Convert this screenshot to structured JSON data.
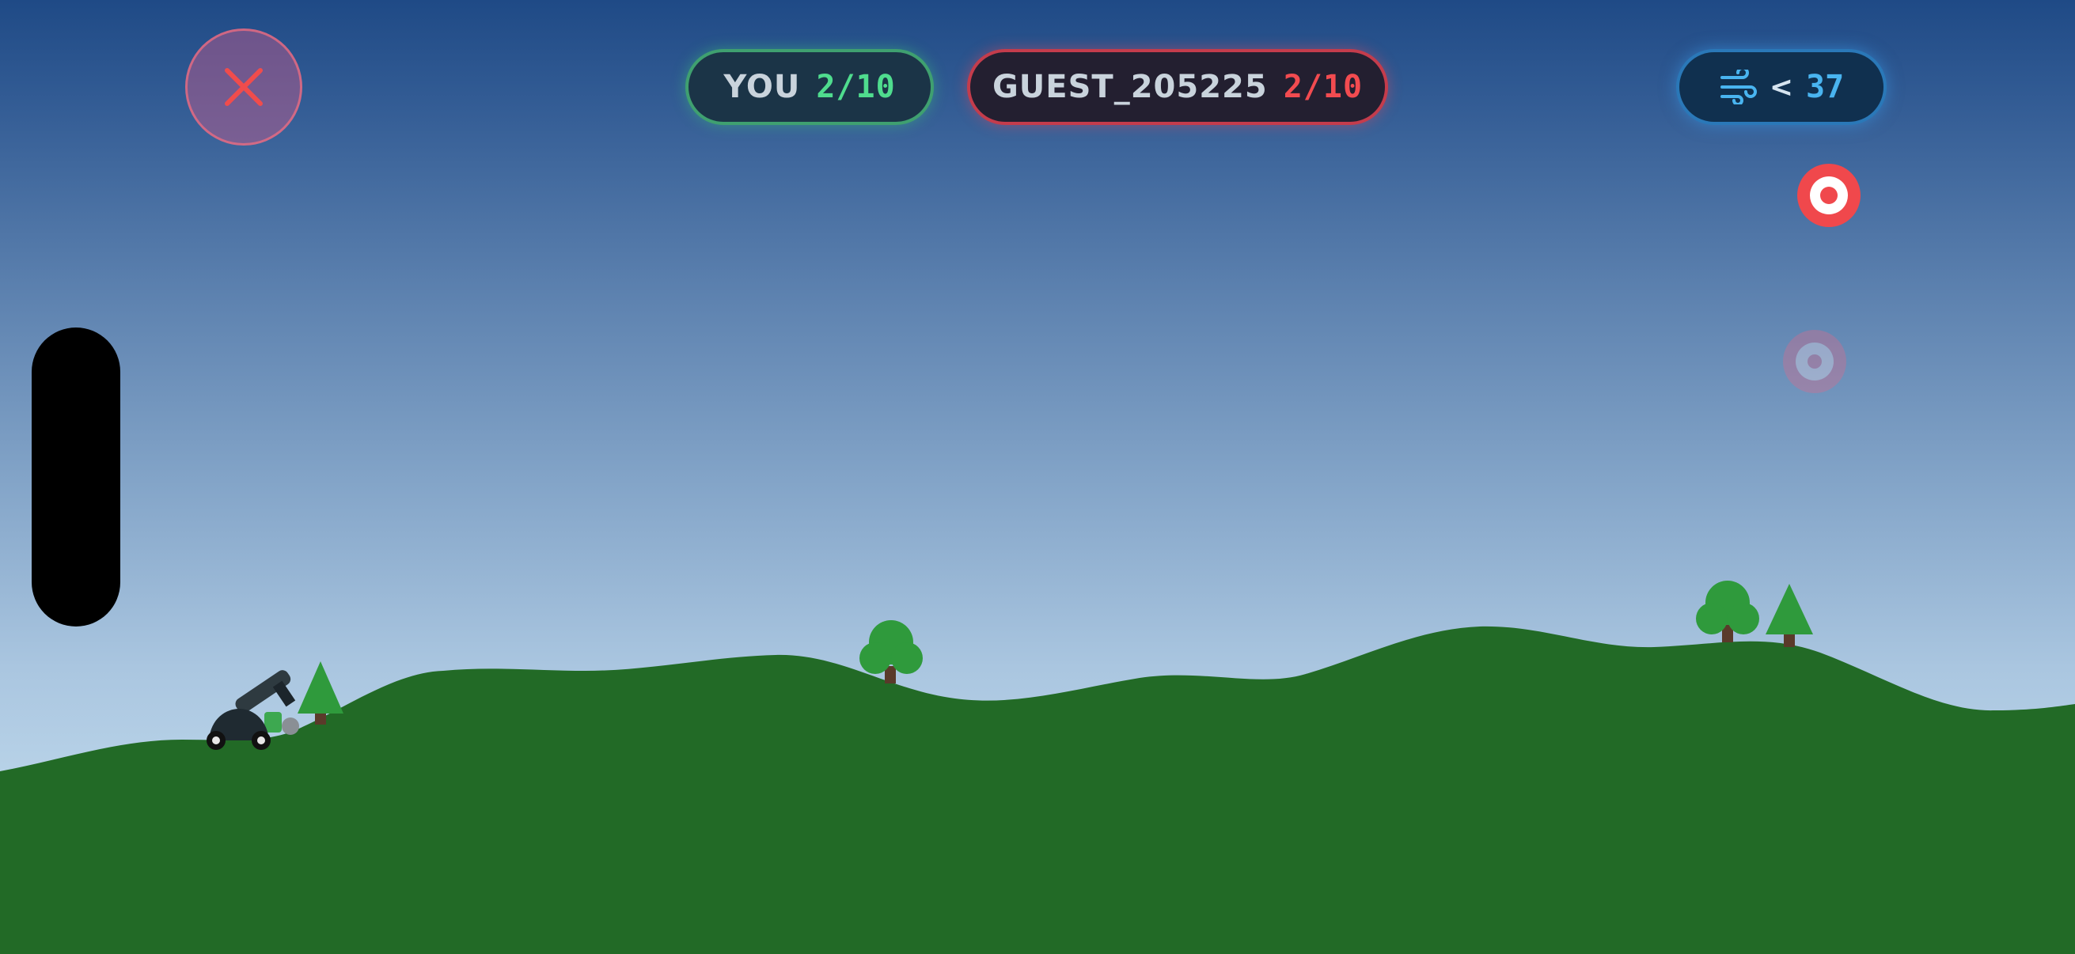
{
  "hud": {
    "close_icon": "close-x-icon",
    "player": {
      "label": "YOU",
      "score": "2/10",
      "accent": "#4fdc8e"
    },
    "opponent": {
      "label": "GUEST_205225",
      "score": "2/10",
      "accent": "#f24b50"
    },
    "wind": {
      "icon": "wind-icon",
      "direction": "<",
      "speed": "37",
      "accent": "#49b4f0"
    }
  },
  "scene": {
    "sky_top": "#1f4a86",
    "sky_bottom": "#bcd6ea",
    "ground_color": "#226a26",
    "tree_color": "#2f9a3c",
    "trunk_color": "#5a3a2a"
  },
  "targets": [
    {
      "name": "target-active",
      "state": "active",
      "color": "#f0484c"
    },
    {
      "name": "target-faded",
      "state": "inactive",
      "color": "#f0484c"
    }
  ]
}
